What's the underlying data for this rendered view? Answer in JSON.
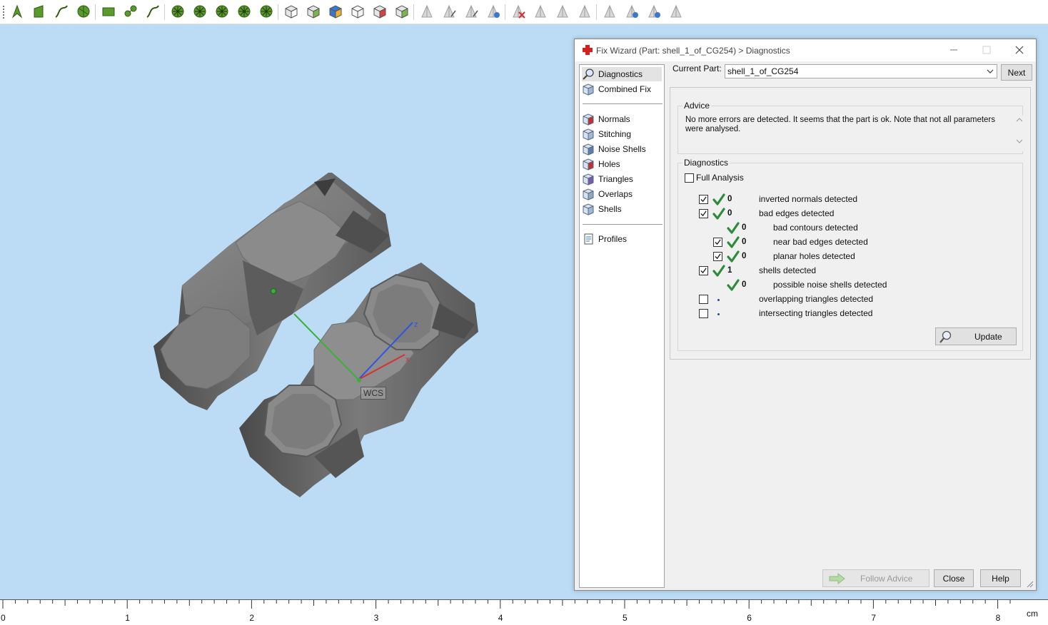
{
  "toolbar": {
    "groups": [
      [
        "arrow-tool-icon",
        "sketch-tool-icon",
        "curve-tool-icon",
        "circle-tool-icon"
      ],
      [
        "rect-select-icon",
        "node-select-icon",
        "path-select-icon"
      ],
      [
        "mesh-select-icon",
        "mesh-node-icon",
        "mesh-star-icon",
        "mesh-circle-icon",
        "mesh-wheel-icon"
      ],
      [
        "cube-wire-icon",
        "cube-front-icon",
        "cube-color-icon",
        "cube-ghost-icon",
        "cube-red-icon",
        "cube-dots-icon"
      ],
      [
        "triangle-select-icon",
        "triangle-paint-icon",
        "triangle-edit-icon",
        "triangle-blue-icon"
      ],
      [
        "triangle-delete-icon",
        "triangle-flip-icon",
        "triangle-copy-icon",
        "triangle-extrude-icon"
      ],
      [
        "measure-icon",
        "measure-grid-icon",
        "measure-blue-icon",
        "measure-box-icon"
      ]
    ]
  },
  "viewport": {
    "background": "#bcdcf5",
    "wcs_label": "WCS",
    "axis_labels": {
      "x": "x",
      "y": "",
      "z": "z"
    }
  },
  "ruler": {
    "labels": [
      "0",
      "1",
      "2",
      "3",
      "4",
      "5",
      "6",
      "7",
      "8"
    ],
    "unit": "cm"
  },
  "dialog": {
    "title": "Fix Wizard (Part: shell_1_of_CG254) > Diagnostics",
    "nav": {
      "items": [
        {
          "label": "Diagnostics",
          "icon": "magnifier-icon",
          "selected": true
        },
        {
          "label": "Combined Fix",
          "icon": "combined-fix-icon",
          "selected": false
        },
        {
          "label": "Normals",
          "icon": "normals-icon",
          "selected": false
        },
        {
          "label": "Stitching",
          "icon": "stitching-icon",
          "selected": false
        },
        {
          "label": "Noise Shells",
          "icon": "noise-shells-icon",
          "selected": false
        },
        {
          "label": "Holes",
          "icon": "holes-icon",
          "selected": false
        },
        {
          "label": "Triangles",
          "icon": "triangles-icon",
          "selected": false
        },
        {
          "label": "Overlaps",
          "icon": "overlaps-icon",
          "selected": false
        },
        {
          "label": "Shells",
          "icon": "shells-icon",
          "selected": false
        },
        {
          "label": "Profiles",
          "icon": "profiles-icon",
          "selected": false
        }
      ]
    },
    "current_part_label": "Current Part:",
    "current_part_value": "shell_1_of_CG254",
    "next_label": "Next",
    "advice": {
      "title": "Advice",
      "text": "No more errors are detected. It seems that the part is ok. Note that not all parameters were analysed."
    },
    "diagnostics": {
      "title": "Diagnostics",
      "full_analysis_label": "Full Analysis",
      "full_analysis_checked": false,
      "rows": [
        {
          "checkbox": true,
          "checked": true,
          "status": "ok",
          "count": "0",
          "label": "inverted normals detected",
          "indent": 0
        },
        {
          "checkbox": true,
          "checked": true,
          "status": "ok",
          "count": "0",
          "label": "bad edges detected",
          "indent": 0
        },
        {
          "checkbox": false,
          "checked": false,
          "status": "ok",
          "count": "0",
          "label": "bad contours detected",
          "indent": 1
        },
        {
          "checkbox": true,
          "checked": true,
          "status": "ok",
          "count": "0",
          "label": "near bad edges detected",
          "indent": 1
        },
        {
          "checkbox": true,
          "checked": true,
          "status": "ok",
          "count": "0",
          "label": "planar holes detected",
          "indent": 1
        },
        {
          "checkbox": true,
          "checked": true,
          "status": "ok",
          "count": "1",
          "label": "shells detected",
          "indent": 0
        },
        {
          "checkbox": false,
          "checked": false,
          "status": "ok",
          "count": "0",
          "label": "possible noise shells detected",
          "indent": 1
        },
        {
          "checkbox": true,
          "checked": false,
          "status": "none",
          "count": "",
          "label": "overlapping triangles detected",
          "indent": 0
        },
        {
          "checkbox": true,
          "checked": false,
          "status": "none",
          "count": "",
          "label": "intersecting triangles detected",
          "indent": 0
        }
      ],
      "update_label": "Update"
    },
    "follow_advice_label": "Follow Advice",
    "close_label": "Close",
    "help_label": "Help",
    "colors": {
      "check_green": "#2e8b3c",
      "title_icon_red": "#d42020"
    }
  }
}
